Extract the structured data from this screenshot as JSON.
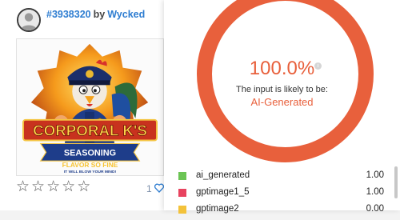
{
  "post": {
    "id_label": "#3938320",
    "by_label": "by",
    "author": "Wycked",
    "image_alt": "Corporal K's Seasoning logo",
    "logo_title": "CORPORAL K'S",
    "logo_banner": "SEASONING",
    "logo_tagline": "FLAVOR SO FINE",
    "logo_small": "IT WILL BLOW YOUR MIND!",
    "rating_stars": 0,
    "likes_count": "1"
  },
  "detector": {
    "percent_text": "100.0%",
    "likely_text": "The input is likely to be:",
    "verdict_text": "AI-Generated",
    "ring_color": "#e8603c",
    "results": [
      {
        "label": "ai_generated",
        "score": "1.00",
        "color": "#6bc454"
      },
      {
        "label": "gptimage1_5",
        "score": "1.00",
        "color": "#e8435f"
      },
      {
        "label": "gptimage2",
        "score": "0.00",
        "color": "#f3c23a"
      }
    ]
  }
}
